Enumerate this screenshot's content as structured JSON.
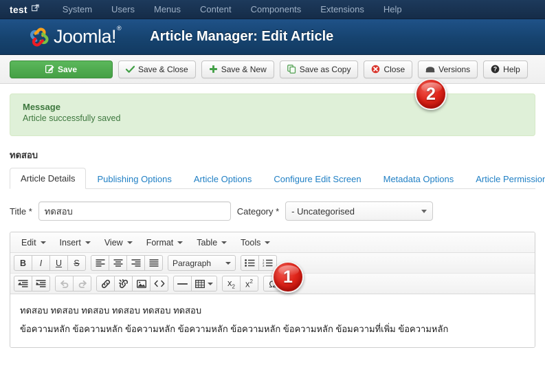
{
  "topbar": {
    "brand": "test",
    "brand_icon": "external-link-icon",
    "menu": [
      {
        "label": "System"
      },
      {
        "label": "Users"
      },
      {
        "label": "Menus"
      },
      {
        "label": "Content"
      },
      {
        "label": "Components"
      },
      {
        "label": "Extensions"
      },
      {
        "label": "Help"
      }
    ]
  },
  "header": {
    "logo_text": "Joomla!",
    "logo_reg": "®",
    "page_title": "Article Manager: Edit Article"
  },
  "toolbar": {
    "buttons": [
      {
        "label": "Save",
        "icon": "edit-pencil-icon",
        "style": "primary"
      },
      {
        "label": "Save & Close",
        "icon": "check-icon",
        "style": "default"
      },
      {
        "label": "Save & New",
        "icon": "plus-icon",
        "style": "default"
      },
      {
        "label": "Save as Copy",
        "icon": "copy-icon",
        "style": "default"
      },
      {
        "label": "Close",
        "icon": "close-circle-icon",
        "style": "default"
      },
      {
        "label": "Versions",
        "icon": "archive-icon",
        "style": "default"
      },
      {
        "label": "Help",
        "icon": "help-circle-icon",
        "style": "default"
      }
    ]
  },
  "alert": {
    "title": "Message",
    "text": "Article successfully saved",
    "bg_color": "#dff0d8",
    "text_color": "#3c763d"
  },
  "article": {
    "heading": "ทดสอบ"
  },
  "tabs": [
    {
      "label": "Article Details",
      "active": true
    },
    {
      "label": "Publishing Options",
      "active": false
    },
    {
      "label": "Article Options",
      "active": false
    },
    {
      "label": "Configure Edit Screen",
      "active": false
    },
    {
      "label": "Metadata Options",
      "active": false
    },
    {
      "label": "Article Permissions",
      "active": false
    }
  ],
  "form": {
    "title_label": "Title *",
    "title_value": "ทดสอบ",
    "title_placeholder": "",
    "category_label": "Category *",
    "category_value": "- Uncategorised"
  },
  "editor": {
    "menubar": [
      {
        "label": "Edit"
      },
      {
        "label": "Insert"
      },
      {
        "label": "View"
      },
      {
        "label": "Format"
      },
      {
        "label": "Table"
      },
      {
        "label": "Tools"
      }
    ],
    "row1": {
      "format_select": "Paragraph"
    },
    "content": {
      "line1": "ทดสอบ ทดสอบ  ทดสอบ ทดสอบ ทดสอบ ทดสอบ",
      "line2": "ข้อความหลัก ข้อความหลัก ข้อความหลัก ข้อความหลัก ข้อความหลัก ข้อความหลัก ข้อมความที่เพิ่ม ข้อความหลัก"
    }
  },
  "callouts": [
    {
      "number": "1"
    },
    {
      "number": "2"
    }
  ]
}
